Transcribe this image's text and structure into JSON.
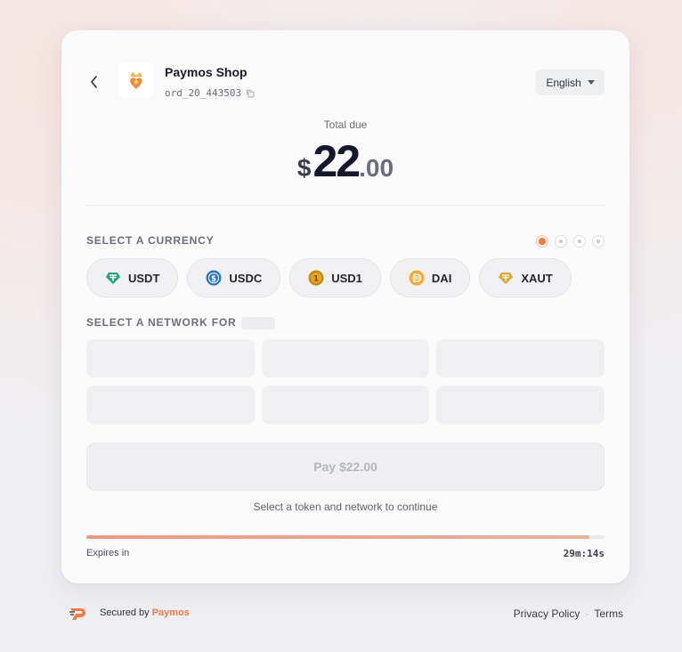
{
  "shop": {
    "name": "Paymos Shop",
    "order_id": "ord_20_443503"
  },
  "language": {
    "selected": "English"
  },
  "total": {
    "label": "Total due",
    "currency": "$",
    "whole": "22",
    "cents": ".00"
  },
  "currency_section": {
    "title": "SELECT A CURRENCY",
    "steps_total": 4,
    "active_step": 1,
    "options": [
      {
        "label": "USDT",
        "icon": "usdt-icon",
        "color": "#26a17b"
      },
      {
        "label": "USDC",
        "icon": "usdc-icon",
        "color": "#2775ca"
      },
      {
        "label": "USD1",
        "icon": "usd1-icon",
        "color": "#c98a10"
      },
      {
        "label": "DAI",
        "icon": "dai-icon",
        "color": "#f5ac37"
      },
      {
        "label": "XAUT",
        "icon": "xaut-icon",
        "color": "#d9a93a"
      }
    ]
  },
  "network_section": {
    "title": "SELECT A NETWORK FOR",
    "placeholders": 6
  },
  "pay_button": {
    "label": "Pay $22.00",
    "enabled": false
  },
  "hint": "Select a token and network to continue",
  "expiry": {
    "label": "Expires in",
    "time": "29m:14s",
    "progress_percent": 97
  },
  "footer": {
    "secured_by": "Secured by",
    "brand": "Paymos",
    "privacy_label": "Privacy Policy",
    "separator": "·",
    "terms_label": "Terms"
  },
  "colors": {
    "accent": "#ee7a44",
    "text": "#1d1f2a"
  }
}
